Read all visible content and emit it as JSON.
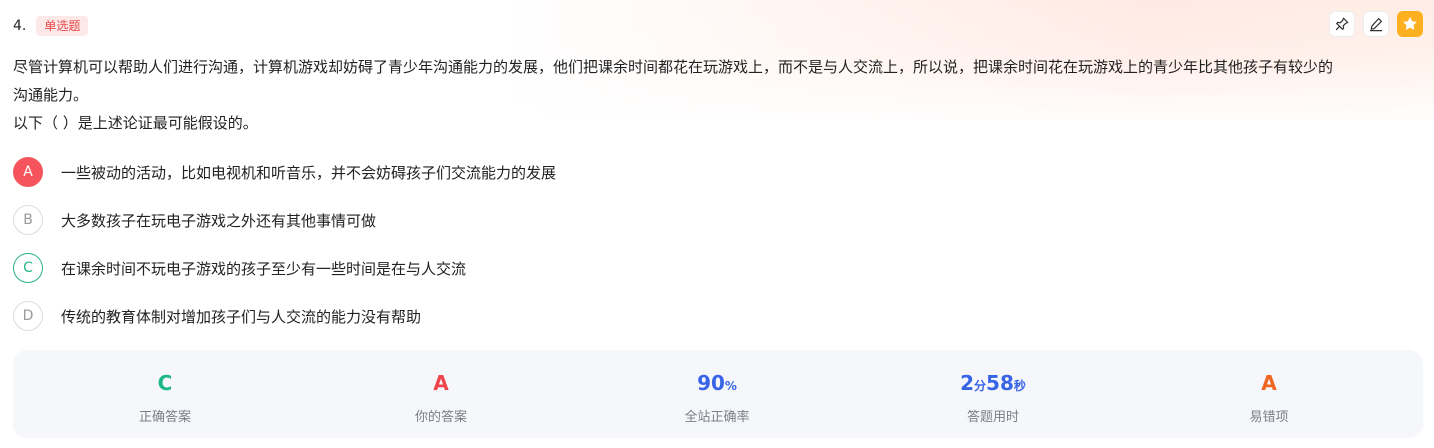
{
  "question": {
    "number": "4.",
    "type": "单选题",
    "stem_line1": "尽管计算机可以帮助人们进行沟通，计算机游戏却妨碍了青少年沟通能力的发展，他们把课余时间都花在玩游戏上，而不是与人交流上，所以说，把课余时间花在玩游戏上的青少年比其他孩子有较少的",
    "stem_line2": "沟通能力。",
    "prompt": "以下（ ）是上述论证最可能假设的。"
  },
  "options": [
    {
      "letter": "A",
      "text": "一些被动的活动，比如电视机和听音乐，并不会妨碍孩子们交流能力的发展",
      "state": "selected-wrong"
    },
    {
      "letter": "B",
      "text": "大多数孩子在玩电子游戏之外还有其他事情可做",
      "state": "normal"
    },
    {
      "letter": "C",
      "text": "在课余时间不玩电子游戏的孩子至少有一些时间是在与人交流",
      "state": "correct"
    },
    {
      "letter": "D",
      "text": "传统的教育体制对增加孩子们与人交流的能力没有帮助",
      "state": "normal"
    }
  ],
  "stats": {
    "correct_answer": {
      "value": "C",
      "label": "正确答案",
      "color": "#1fb785"
    },
    "your_answer": {
      "value": "A",
      "label": "你的答案",
      "color": "#ef4449"
    },
    "accuracy": {
      "number": "90",
      "unit": "%",
      "label": "全站正确率",
      "color": "#3864e6"
    },
    "time_used": {
      "min": "2",
      "min_unit": "分",
      "sec": "58",
      "sec_unit": "秒",
      "label": "答题用时",
      "color": "#3864e6"
    },
    "error_prone": {
      "value": "A",
      "label": "易错项",
      "color": "#f0651f"
    }
  },
  "toolbar": {
    "icons": [
      "pin-icon",
      "edit-icon",
      "star-icon"
    ]
  },
  "colors": {
    "tag_red": "#e8474a",
    "wrong_red": "#f5545c",
    "correct_green": "#27b98a",
    "favorite_orange": "#ffb020"
  }
}
